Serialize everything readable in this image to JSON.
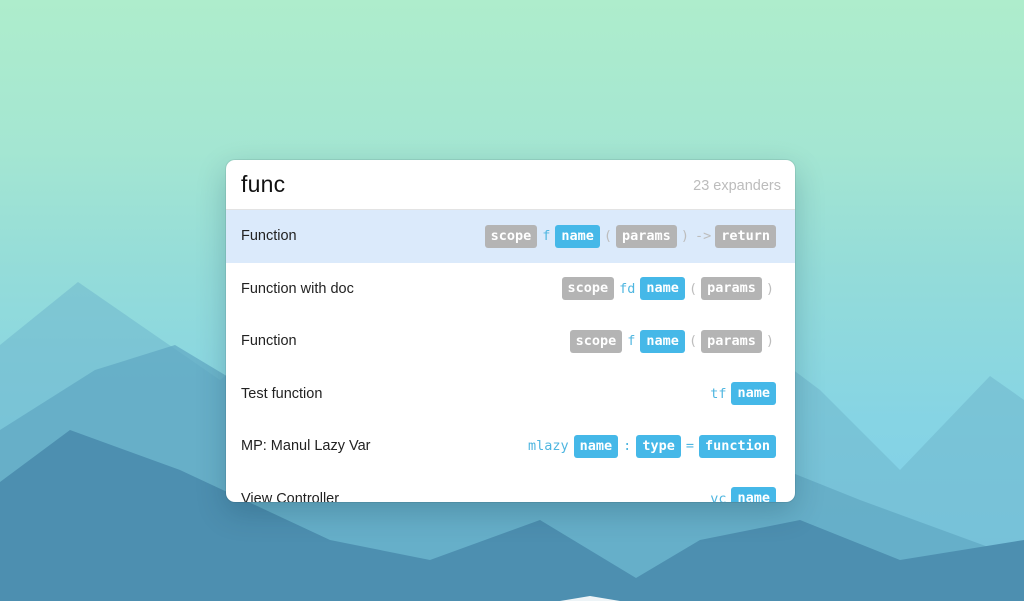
{
  "search": {
    "query": "func",
    "count_text": "23 expanders"
  },
  "colors": {
    "selected_row": "#dbeafb",
    "placeholder_token": "#b4b4b4",
    "name_token": "#45b8e8",
    "literal_text": "#4fb6e0"
  },
  "results": [
    {
      "name": "Function",
      "selected": true,
      "parts": [
        {
          "kind": "tok-grey",
          "text": "scope"
        },
        {
          "kind": "lit",
          "text": "f"
        },
        {
          "kind": "tok-blue",
          "text": "name"
        },
        {
          "kind": "punct",
          "text": "("
        },
        {
          "kind": "tok-grey",
          "text": "params"
        },
        {
          "kind": "punct",
          "text": ")"
        },
        {
          "kind": "punct",
          "text": "->"
        },
        {
          "kind": "tok-grey",
          "text": "return"
        }
      ]
    },
    {
      "name": "Function with doc",
      "selected": false,
      "parts": [
        {
          "kind": "tok-grey",
          "text": "scope"
        },
        {
          "kind": "lit",
          "text": "fd"
        },
        {
          "kind": "tok-blue",
          "text": "name"
        },
        {
          "kind": "punct",
          "text": "("
        },
        {
          "kind": "tok-grey",
          "text": "params"
        },
        {
          "kind": "punct",
          "text": ")"
        }
      ]
    },
    {
      "name": "Function",
      "selected": false,
      "parts": [
        {
          "kind": "tok-grey",
          "text": "scope"
        },
        {
          "kind": "lit",
          "text": "f"
        },
        {
          "kind": "tok-blue",
          "text": "name"
        },
        {
          "kind": "punct",
          "text": "("
        },
        {
          "kind": "tok-grey",
          "text": "params"
        },
        {
          "kind": "punct",
          "text": ")"
        }
      ]
    },
    {
      "name": "Test function",
      "selected": false,
      "parts": [
        {
          "kind": "lit",
          "text": "tf"
        },
        {
          "kind": "tok-blue",
          "text": "name"
        }
      ]
    },
    {
      "name": "MP: Manul Lazy Var",
      "selected": false,
      "parts": [
        {
          "kind": "lit",
          "text": "mlazy"
        },
        {
          "kind": "tok-blue",
          "text": "name"
        },
        {
          "kind": "lit",
          "text": ":"
        },
        {
          "kind": "tok-blue",
          "text": "type"
        },
        {
          "kind": "lit",
          "text": "="
        },
        {
          "kind": "tok-blue",
          "text": "function"
        }
      ]
    },
    {
      "name": "View Controller",
      "selected": false,
      "parts": [
        {
          "kind": "lit",
          "text": "vc"
        },
        {
          "kind": "tok-blue",
          "text": "name"
        }
      ]
    }
  ]
}
